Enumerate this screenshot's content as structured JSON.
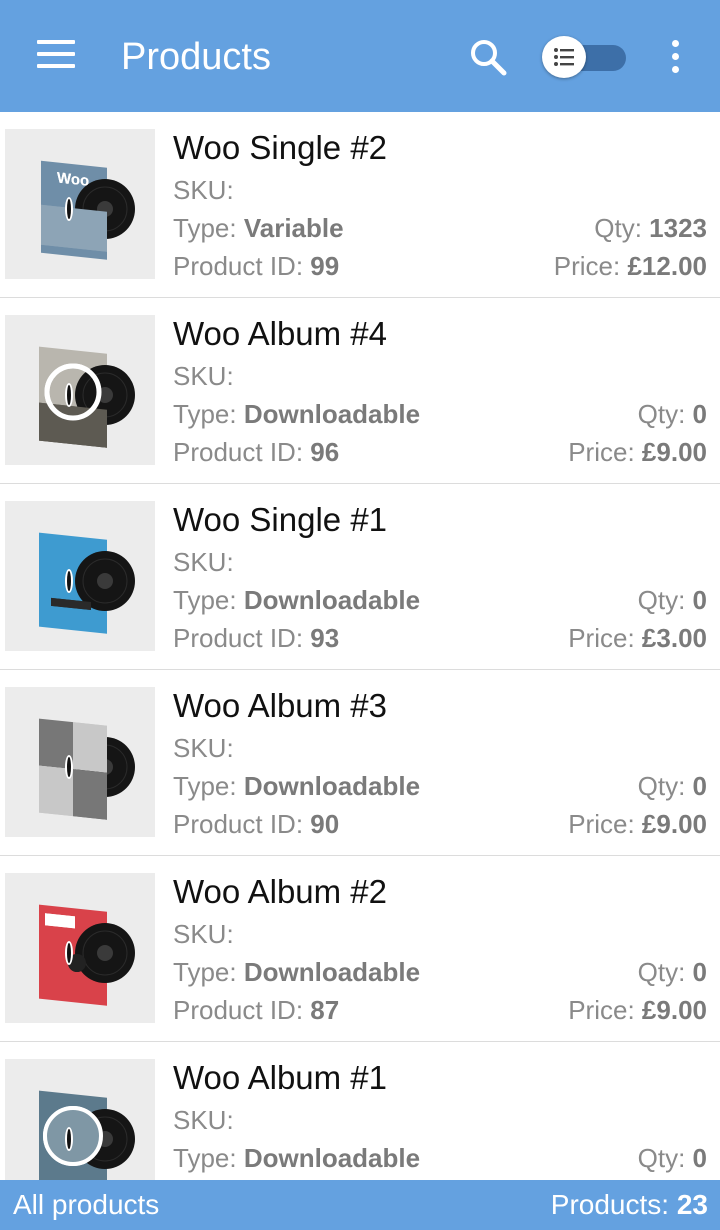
{
  "appbar": {
    "title": "Products",
    "icons": [
      "menu-icon",
      "search-icon",
      "list-view-toggle",
      "more-vert-icon"
    ]
  },
  "labels": {
    "sku": "SKU:",
    "type": "Type:",
    "product_id": "Product ID:",
    "qty": "Qty:",
    "price": "Price:"
  },
  "products": [
    {
      "name": "Woo Single #2",
      "sku": "",
      "type": "Variable",
      "id": "99",
      "qty": "1323",
      "price": "£12.00",
      "cover": "woo-sky"
    },
    {
      "name": "Woo Album #4",
      "sku": "",
      "type": "Downloadable",
      "id": "96",
      "qty": "0",
      "price": "£9.00",
      "cover": "woothemes-circle"
    },
    {
      "name": "Woo Single #1",
      "sku": "",
      "type": "Downloadable",
      "id": "93",
      "qty": "0",
      "price": "£3.00",
      "cover": "woothemes-blue"
    },
    {
      "name": "Woo Album #3",
      "sku": "",
      "type": "Downloadable",
      "id": "90",
      "qty": "0",
      "price": "£9.00",
      "cover": "ninja-grid"
    },
    {
      "name": "Woo Album #2",
      "sku": "",
      "type": "Downloadable",
      "id": "87",
      "qty": "0",
      "price": "£9.00",
      "cover": "woo-red"
    },
    {
      "name": "Woo Album #1",
      "sku": "",
      "type": "Downloadable",
      "id": "",
      "qty": "0",
      "price": "",
      "cover": "woothemes-grey"
    }
  ],
  "bottombar": {
    "left": "All products",
    "count_label": "Products:",
    "count": "23"
  },
  "colors": {
    "primary": "#64a1e0",
    "toggle_track": "#3d6fa8"
  }
}
